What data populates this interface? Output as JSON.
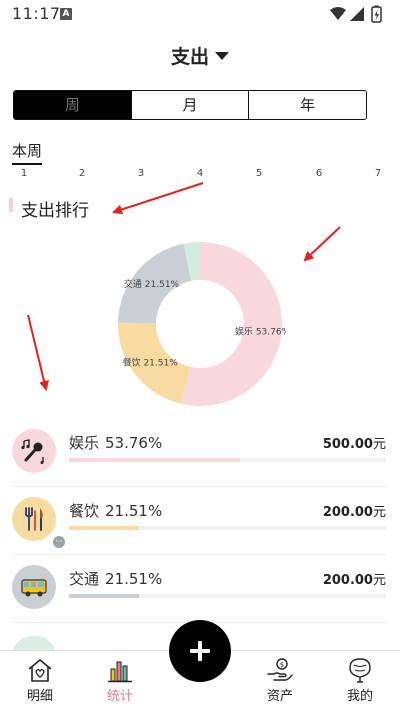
{
  "status_bar": {
    "time": "11:17",
    "notification_letter": "A",
    "icons": [
      "wifi-icon",
      "signal-icon",
      "battery-charging-icon"
    ]
  },
  "header": {
    "title": "支出"
  },
  "period_tabs": [
    {
      "label": "周",
      "selected": true
    },
    {
      "label": "月",
      "selected": false
    },
    {
      "label": "年",
      "selected": false
    }
  ],
  "week_strip": {
    "label": "本周",
    "numbers": [
      "1",
      "2",
      "3",
      "4",
      "5",
      "6",
      "7"
    ]
  },
  "ranking": {
    "title": "支出排行"
  },
  "chart_data": {
    "type": "pie",
    "donut": true,
    "slices": [
      {
        "label": "娱乐 53.76%",
        "value": 53.76,
        "color": "#f8d8dc"
      },
      {
        "label": "餐饮 21.51%",
        "value": 21.51,
        "color": "#f7dba0"
      },
      {
        "label": "交通 21.51%",
        "value": 21.51,
        "color": "#c9cfd4"
      },
      {
        "label": "",
        "value": 3.22,
        "color": "#d4ebdf"
      }
    ]
  },
  "categories": [
    {
      "name": "娱乐",
      "percent": "53.76%",
      "amount": "500.00",
      "unit": "元",
      "icon": "music-microphone-icon",
      "color": "#f8d8dc",
      "bar_fraction": 0.54,
      "bar_color": "#f8d8dc"
    },
    {
      "name": "餐饮",
      "percent": "21.51%",
      "amount": "200.00",
      "unit": "元",
      "icon": "fork-knife-icon",
      "color": "#f7dba0",
      "bar_fraction": 0.22,
      "bar_color": "#f7dba0"
    },
    {
      "name": "交通",
      "percent": "21.51%",
      "amount": "200.00",
      "unit": "元",
      "icon": "bus-icon",
      "color": "#c9cfd4",
      "bar_fraction": 0.22,
      "bar_color": "#c9cfd4"
    }
  ],
  "bottom_nav": {
    "items": [
      {
        "label": "明细",
        "icon": "house-heart-icon",
        "active": false
      },
      {
        "label": "统计",
        "icon": "bar-chart-icon",
        "active": true
      },
      {
        "label": "资产",
        "icon": "hand-coin-icon",
        "active": false
      },
      {
        "label": "我的",
        "icon": "balloon-icon",
        "active": false
      }
    ],
    "active_color": "#e77d8e"
  }
}
